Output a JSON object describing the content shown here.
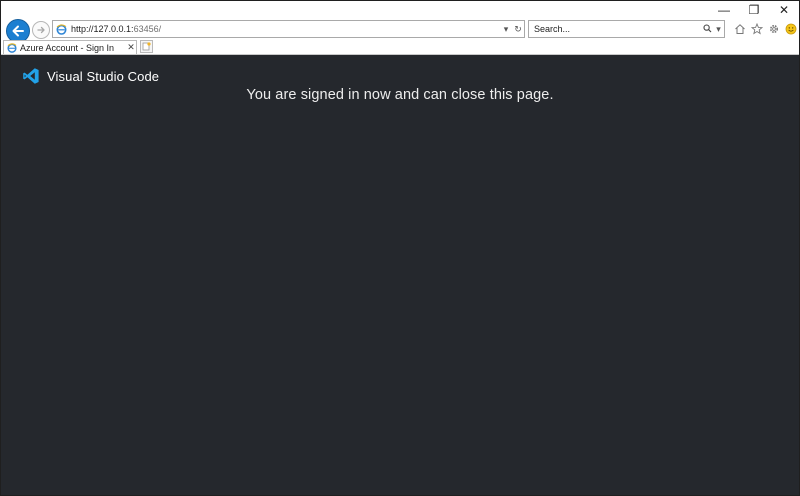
{
  "window": {
    "controls": {
      "minimize": "—",
      "restore": "❐",
      "close": "✕"
    }
  },
  "nav": {
    "address": {
      "url_host": "http://127.0.0.1:",
      "url_rest": "63456/"
    },
    "search": {
      "placeholder": "Search..."
    }
  },
  "tabs": [
    {
      "title": "Azure Account - Sign In"
    }
  ],
  "page": {
    "brand": "Visual Studio Code",
    "message": "You are signed in now and can close this page."
  },
  "colors": {
    "page_background": "#25282d",
    "vscode_blue": "#22a2e8",
    "back_button": "#1c7fd1"
  }
}
